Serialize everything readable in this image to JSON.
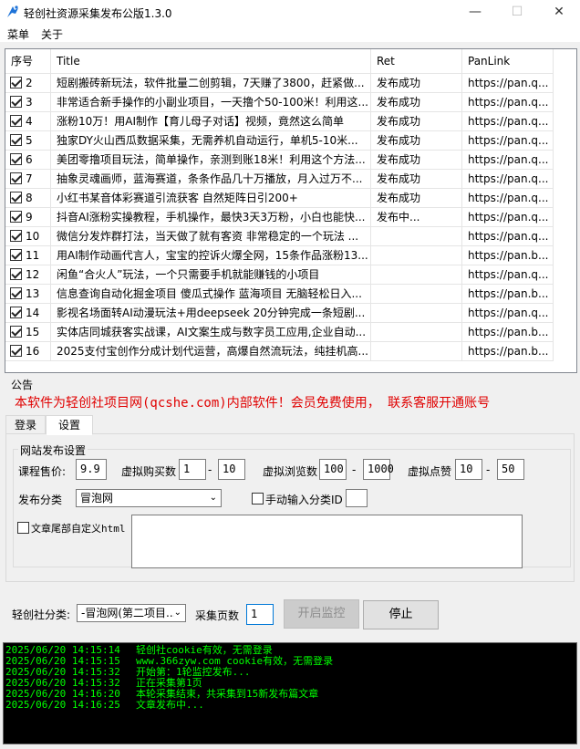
{
  "window": {
    "title": "轻创社资源采集发布公版1.3.0",
    "minimize": "—",
    "maximize": "☐",
    "close": "✕"
  },
  "menu": [
    "菜单",
    "关于"
  ],
  "grid": {
    "columns": [
      "序号",
      "Title",
      "Ret",
      "PanLink"
    ],
    "rows": [
      {
        "num": "2",
        "title": "短剧搬砖新玩法，软件批量二创剪辑，7天赚了3800，赶紧做...",
        "ret": "发布成功",
        "link": "https://pan.q..."
      },
      {
        "num": "3",
        "title": "非常适合新手操作的小副业项目，一天撸个50-100米！利用这...",
        "ret": "发布成功",
        "link": "https://pan.q..."
      },
      {
        "num": "4",
        "title": "涨粉10万！用AI制作【育儿母子对话】视频，竟然这么简单",
        "ret": "发布成功",
        "link": "https://pan.q..."
      },
      {
        "num": "5",
        "title": "独家DY火山西瓜数据采集，无需养机自动运行，单机5-10米...",
        "ret": "发布成功",
        "link": "https://pan.q..."
      },
      {
        "num": "6",
        "title": "美团零撸项目玩法，简单操作，亲测到账18米！利用这个方法...",
        "ret": "发布成功",
        "link": "https://pan.q..."
      },
      {
        "num": "7",
        "title": "抽象灵魂画师，蓝海赛道，条条作品几十万播放，月入过万不...",
        "ret": "发布成功",
        "link": "https://pan.q..."
      },
      {
        "num": "8",
        "title": "小红书某音体彩赛道引流获客 自然矩阵日引200+",
        "ret": "发布成功",
        "link": "https://pan.q..."
      },
      {
        "num": "9",
        "title": "抖音AI涨粉实操教程，手机操作，最快3天3万粉，小白也能快...",
        "ret": "发布中...",
        "link": "https://pan.q..."
      },
      {
        "num": "10",
        "title": "微信分发炸群打法，当天做了就有客资 非常稳定的一个玩法 ...",
        "ret": "",
        "link": "https://pan.q..."
      },
      {
        "num": "11",
        "title": "用AI制作动画代言人，宝宝的控诉火爆全网，15条作品涨粉13...",
        "ret": "",
        "link": "https://pan.b..."
      },
      {
        "num": "12",
        "title": "闲鱼“合火人”玩法，一个只需要手机就能赚钱的小项目",
        "ret": "",
        "link": "https://pan.q..."
      },
      {
        "num": "13",
        "title": "信息查询自动化掘金项目 傻瓜式操作  蓝海项目 无脑轻松日入...",
        "ret": "",
        "link": "https://pan.b..."
      },
      {
        "num": "14",
        "title": "影视名场面转AI动漫玩法+用deepseek 20分钟完成一条短剧...",
        "ret": "",
        "link": "https://pan.q..."
      },
      {
        "num": "15",
        "title": "实体店同城获客实战课，AI文案生成与数字员工应用,企业自动...",
        "ret": "",
        "link": "https://pan.b..."
      },
      {
        "num": "16",
        "title": "2025支付宝创作分成计划代运营，高爆自然流玩法，纯挂机高...",
        "ret": "",
        "link": "https://pan.b..."
      }
    ]
  },
  "notice": {
    "label": "公告",
    "text": "本软件为轻创社项目网(qcshe.com)内部软件！会员免费使用，  联系客服开通账号"
  },
  "tabs": [
    "登录",
    "设置"
  ],
  "settings": {
    "group_title": "网站发布设置",
    "price_label": "课程售价:",
    "price_value": "9.9",
    "buy_label": "虚拟购买数",
    "buy_min": "1",
    "buy_max": "10",
    "view_label": "虚拟浏览数",
    "view_min": "100",
    "view_max": "1000",
    "like_label": "虚拟点赞",
    "like_min": "10",
    "like_max": "50",
    "dash": "-",
    "category_label": "发布分类",
    "category_value": "冒泡网",
    "manual_cat_label": "手动输入分类ID",
    "manual_cat_value": "",
    "custom_html_label": "文章尾部自定义html",
    "custom_html_value": ""
  },
  "bottom": {
    "cat_label": "轻创社分类:",
    "cat_value": "-冒泡网(第二项目...",
    "pages_label": "采集页数",
    "pages_value": "1",
    "start_button": "开启监控",
    "stop_button": "停止"
  },
  "log": [
    {
      "time": "2025/06/20 14:15:14",
      "msg": "轻创社cookie有效，无需登录"
    },
    {
      "time": "2025/06/20 14:15:15",
      "msg": "www.366zyw.com  cookie有效，无需登录"
    },
    {
      "time": "2025/06/20 14:15:32",
      "msg": "开始第：1轮监控发布..."
    },
    {
      "time": "2025/06/20 14:15:32",
      "msg": "正在采集第1页"
    },
    {
      "time": "2025/06/20 14:16:20",
      "msg": "本轮采集结束，共采集到15新发布篇文章"
    },
    {
      "time": "2025/06/20 14:16:25",
      "msg": "文章发布中..."
    }
  ]
}
